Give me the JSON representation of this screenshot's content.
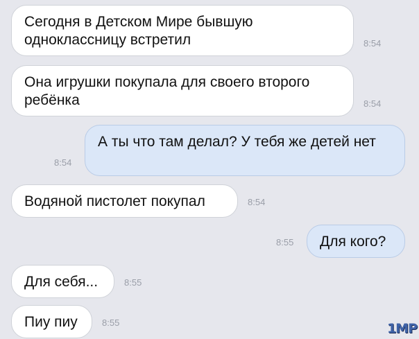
{
  "messages": [
    {
      "direction": "incoming",
      "text": "Сегодня в Детском Мире бывшую одноклассницу встретил",
      "time": "8:54"
    },
    {
      "direction": "incoming",
      "text": "Она игрушки покупала для своего второго ребёнка",
      "time": "8:54"
    },
    {
      "direction": "outgoing",
      "text": "А ты что там делал? У тебя же детей нет",
      "time": "8:54"
    },
    {
      "direction": "incoming",
      "text": "Водяной пистолет покупал",
      "time": "8:54"
    },
    {
      "direction": "outgoing",
      "text": "Для кого?",
      "time": "8:55"
    },
    {
      "direction": "incoming",
      "text": "Для себя...",
      "time": "8:55"
    },
    {
      "direction": "incoming",
      "text": "Пиу пиу",
      "time": "8:55"
    }
  ],
  "watermark": "1MP",
  "colors": {
    "background": "#e6e7ed",
    "incoming_bubble": "#ffffff",
    "outgoing_bubble": "#dbe7f8",
    "timestamp": "#9a9ea8",
    "watermark": "#3f63a8"
  }
}
